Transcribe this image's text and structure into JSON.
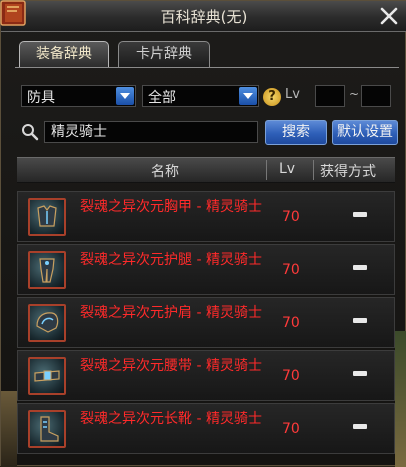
{
  "window": {
    "title": "百科辞典(无)"
  },
  "tabs": [
    {
      "label": "装备辞典",
      "active": true
    },
    {
      "label": "卡片辞典",
      "active": false
    }
  ],
  "filters": {
    "type": "防具",
    "category": "全部",
    "lv_label": "Lv",
    "lv_from": "",
    "lv_to": "",
    "tilde": "~"
  },
  "search": {
    "value": "精灵骑士",
    "search_label": "搜索",
    "default_label": "默认设置"
  },
  "table": {
    "headers": {
      "name": "名称",
      "lv": "Lv",
      "how": "获得方式"
    },
    "rows": [
      {
        "name": "裂魂之异次元胸甲 - 精灵骑士",
        "lv": "70",
        "icon": "chest-armor-icon"
      },
      {
        "name": "裂魂之异次元护腿 - 精灵骑士",
        "lv": "70",
        "icon": "leg-armor-icon"
      },
      {
        "name": "裂魂之异次元护肩 - 精灵骑士",
        "lv": "70",
        "icon": "shoulder-armor-icon"
      },
      {
        "name": "裂魂之异次元腰带 - 精灵骑士",
        "lv": "70",
        "icon": "belt-icon"
      },
      {
        "name": "裂魂之异次元长靴 - 精灵骑士",
        "lv": "70",
        "icon": "boots-icon"
      }
    ]
  },
  "colors": {
    "item_name": "#ff2a2a",
    "accent_blue": "#2e5fb8",
    "icon_border": "#a8402a"
  }
}
